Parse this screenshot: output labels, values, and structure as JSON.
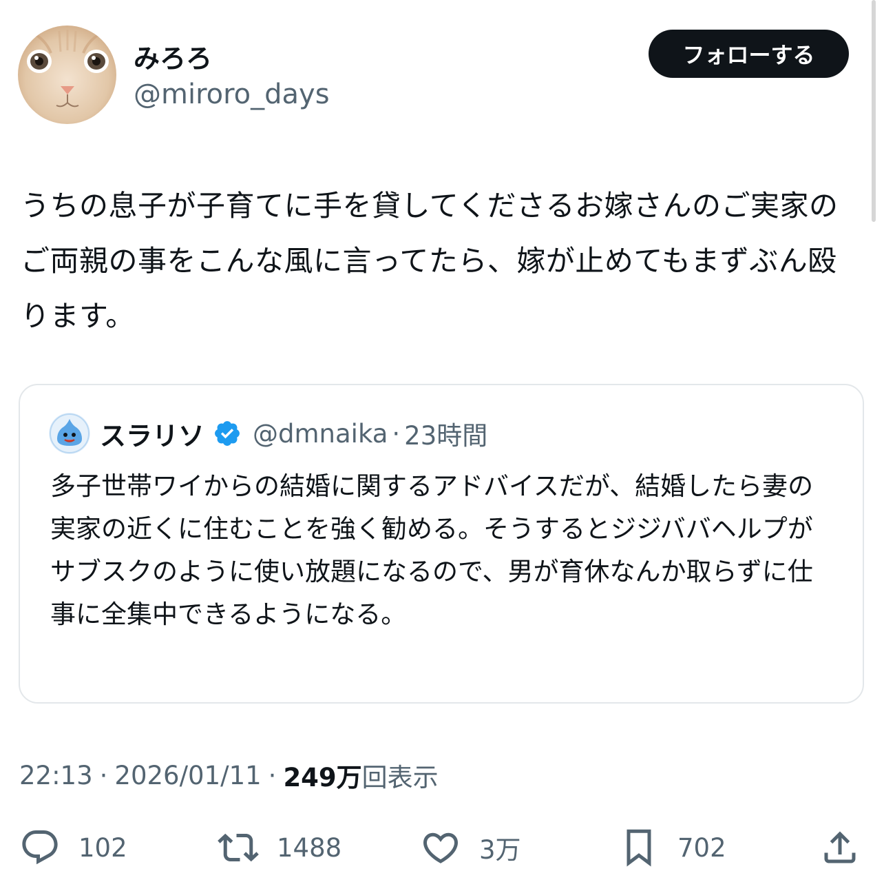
{
  "author": {
    "display_name": "みろろ",
    "handle": "@miroro_days"
  },
  "follow_button": {
    "label": "フォローする"
  },
  "tweet": {
    "text": "うちの息子が子育てに手を貸してくださるお嫁さんのご実家のご両親の事をこんな風に言ってたら、嫁が止めてもまずぶん殴ります。"
  },
  "quote": {
    "display_name": "スラリソ",
    "handle": "@dmnaika",
    "separator": "·",
    "time": "23時間",
    "verified": true,
    "text": "多子世帯ワイからの結婚に関するアドバイスだが、結婚したら妻の実家の近くに住むことを強く勧める。そうするとジジババヘルプがサブスクのように使い放題になるので、男が育休なんか取らずに仕事に全集中できるようになる。"
  },
  "meta": {
    "time": "22:13",
    "sep": "·",
    "date": "2026/01/11",
    "views_count": "249万",
    "views_label": "回表示"
  },
  "actions": {
    "reply_count": "102",
    "retweet_count": "1488",
    "like_count": "3万",
    "bookmark_count": "702"
  },
  "colors": {
    "text_primary": "#0f1419",
    "text_secondary": "#536471",
    "verified_blue": "#1d9bf0",
    "border": "#e3e7ea"
  },
  "icons": {
    "reply": "speech-bubble-icon",
    "retweet": "retweet-arrows-icon",
    "like": "heart-icon",
    "bookmark": "bookmark-icon",
    "share": "share-upload-icon",
    "verified": "verified-badge-icon"
  }
}
